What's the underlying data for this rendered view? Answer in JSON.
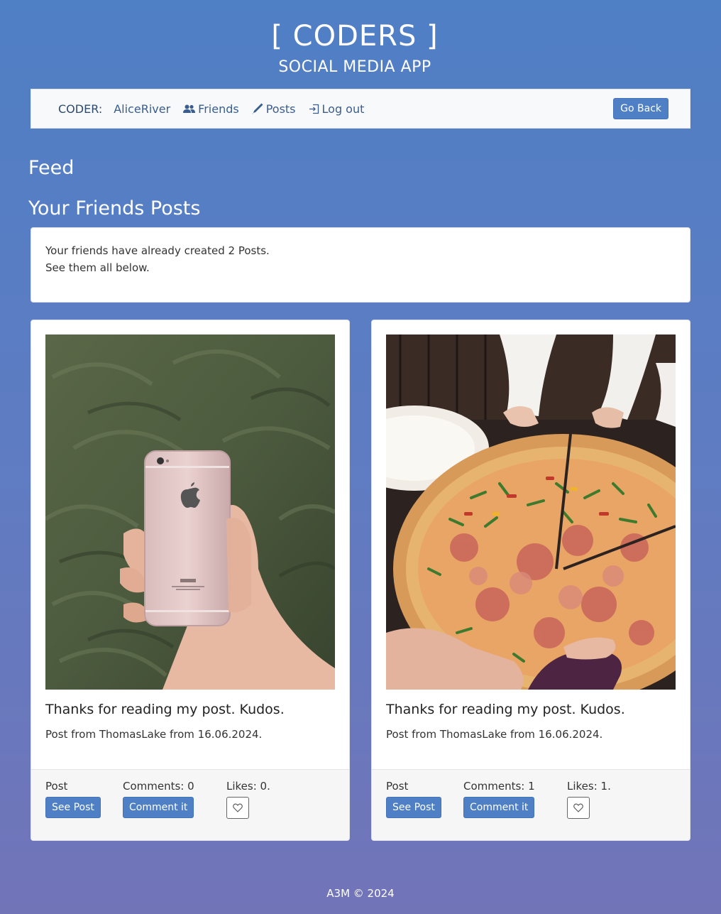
{
  "header": {
    "title": "[ CODERS ]",
    "subtitle": "SOCIAL MEDIA APP"
  },
  "nav": {
    "coder_label": "CODER:",
    "username": "AliceRiver",
    "friends": "Friends",
    "posts": "Posts",
    "logout": "Log out",
    "go_back": "Go Back"
  },
  "main": {
    "feed_title": "Feed",
    "friends_posts_title": "Your Friends Posts",
    "info_line1": "Your friends have already created 2 Posts.",
    "info_line2": "See them all below."
  },
  "posts": [
    {
      "image": "hand-holding-rose-gold-iphone-in-grass",
      "title": "Thanks for reading my post. Kudos.",
      "meta": "Post from ThomasLake from 16.06.2024.",
      "post_label": "Post",
      "see_post": "See Post",
      "comments": "Comments: 0",
      "comment_it": "Comment it",
      "likes": "Likes: 0."
    },
    {
      "image": "hands-taking-pizza-slices",
      "title": "Thanks for reading my post. Kudos.",
      "meta": "Post from ThomasLake from 16.06.2024.",
      "post_label": "Post",
      "see_post": "See Post",
      "comments": "Comments: 1",
      "comment_it": "Comment it",
      "likes": "Likes: 1."
    }
  ],
  "footer": {
    "text": "A3M © 2024"
  },
  "colors": {
    "accent": "#4f7fc5",
    "nav_bg": "#f8f9fa"
  }
}
